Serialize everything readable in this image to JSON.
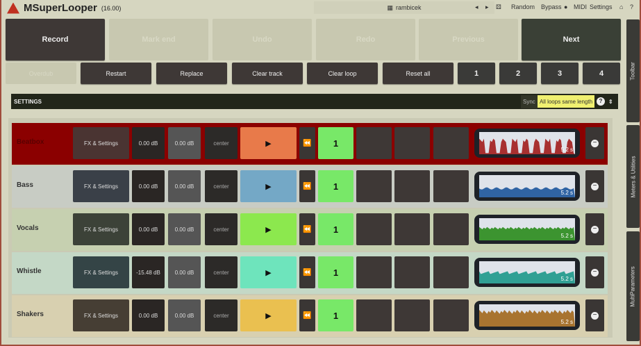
{
  "app": {
    "title": "MSuperLooper",
    "version": "(16.00)"
  },
  "toolbar": {
    "preset": "rambicek",
    "random": "Random",
    "bypass": "Bypass",
    "midi": "MIDI",
    "settings": "Settings"
  },
  "main_buttons": [
    "Record",
    "Mark end",
    "Undo",
    "Redo",
    "Previous",
    "Next"
  ],
  "second_row": {
    "faded": "Overdub",
    "buttons": [
      "Restart",
      "Replace",
      "Clear track",
      "Clear loop",
      "Reset all"
    ],
    "tracks": [
      "1",
      "2",
      "3",
      "4"
    ]
  },
  "settings": {
    "label": "SETTINGS",
    "sync_label": "Sync",
    "sync_value": "All loops same length",
    "help": "?"
  },
  "side_tabs": [
    "Toolbar",
    "Meters & Utilities",
    "MultiParameters"
  ],
  "tracks": [
    {
      "name": "Beatbox",
      "fx": "FX & Settings",
      "volume": "0.00 dB",
      "gain": "0.00 dB",
      "pan": "center",
      "slot": "1",
      "length": "5.2 s",
      "bg": "#8b0000",
      "play": "#e87a4a",
      "wave": "#a83030",
      "fx_bg": "#4a3432",
      "name_color": "#5a0000"
    },
    {
      "name": "Bass",
      "fx": "FX & Settings",
      "volume": "0.00 dB",
      "gain": "0.00 dB",
      "pan": "center",
      "slot": "1",
      "length": "5.2 s",
      "bg": "#c8ccc4",
      "play": "#74a8c6",
      "wave": "#3064a4",
      "fx_bg": "#3a4048",
      "name_color": "#333"
    },
    {
      "name": "Vocals",
      "fx": "FX & Settings",
      "volume": "0.00 dB",
      "gain": "0.00 dB",
      "pan": "center",
      "slot": "1",
      "length": "5.2 s",
      "bg": "#c6d0b0",
      "play": "#8ce84e",
      "wave": "#3c9430",
      "fx_bg": "#3c4238",
      "name_color": "#333"
    },
    {
      "name": "Whistle",
      "fx": "FX & Settings",
      "volume": "-15.48 dB",
      "gain": "0.00 dB",
      "pan": "center",
      "slot": "1",
      "length": "5.2 s",
      "bg": "#c4d8c6",
      "play": "#6ee4bc",
      "wave": "#30a094",
      "fx_bg": "#344446",
      "name_color": "#333"
    },
    {
      "name": "Shakers",
      "fx": "FX & Settings",
      "volume": "0.00 dB",
      "gain": "0.00 dB",
      "pan": "center",
      "slot": "1",
      "length": "5.2 s",
      "bg": "#d8d0b0",
      "play": "#eac050",
      "wave": "#a87430",
      "fx_bg": "#463e34",
      "name_color": "#333"
    }
  ]
}
